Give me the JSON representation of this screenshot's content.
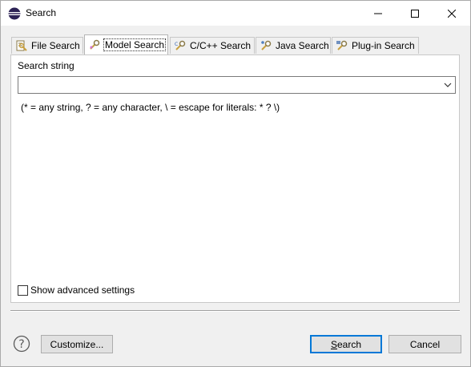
{
  "window": {
    "title": "Search"
  },
  "tabs": [
    {
      "label": "File Search",
      "icon": "file-search-icon",
      "selected": false
    },
    {
      "label": "Model Search",
      "icon": "model-search-icon",
      "selected": true
    },
    {
      "label": "C/C++ Search",
      "icon": "cpp-search-icon",
      "selected": false
    },
    {
      "label": "Java Search",
      "icon": "java-search-icon",
      "selected": false
    },
    {
      "label": "Plug-in Search",
      "icon": "plugin-search-icon",
      "selected": false
    }
  ],
  "panel": {
    "search_label": "Search string",
    "search_value": "",
    "hint": "(* = any string, ? = any character, \\ = escape for literals: * ? \\)",
    "advanced_label": "Show advanced settings",
    "advanced_checked": false
  },
  "buttons": {
    "customize": "Customize...",
    "search_first": "S",
    "search_rest": "earch",
    "cancel": "Cancel"
  },
  "colors": {
    "accent": "#0078d7",
    "eclipse_purple": "#2c2255"
  }
}
